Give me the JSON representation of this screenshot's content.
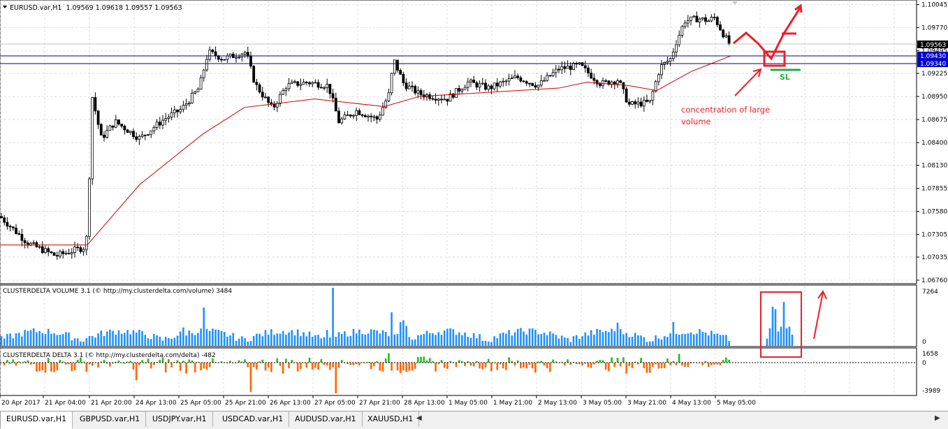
{
  "header": {
    "symbol_info": "EURUSD.var,H1",
    "ohlc": "1.09569 1.09618 1.09557 1.09563"
  },
  "price_axis": {
    "ticks": [
      "1.10045",
      "1.09770",
      "1.09495",
      "1.09225",
      "1.08950",
      "1.08675",
      "1.08400",
      "1.08130",
      "1.07855",
      "1.07580",
      "1.07305",
      "1.07035",
      "1.06760"
    ],
    "current_price": "1.09563",
    "level_upper": "1.09430",
    "level_lower": "1.09340"
  },
  "volume_panel": {
    "title": "CLUSTERDELTA VOLUME 3.1 (© http://my.clusterdelta.com/volume) 3484",
    "ticks": [
      "7264",
      "0"
    ]
  },
  "delta_panel": {
    "title": "CLUSTERDELTA DELTA 3.1 (© http://my.clusterdelta.com/delta) -482",
    "ticks": [
      "1658",
      "0",
      "-3989"
    ]
  },
  "time_axis": {
    "labels": [
      "20 Apr 2017",
      "21 Apr 04:00",
      "21 Apr 20:00",
      "24 Apr 13:00",
      "25 Apr 05:00",
      "25 Apr 21:00",
      "26 Apr 13:00",
      "27 Apr 05:00",
      "27 Apr 21:00",
      "28 Apr 13:00",
      "1 May 05:00",
      "1 May 21:00",
      "2 May 13:00",
      "3 May 05:00",
      "3 May 21:00",
      "4 May 13:00",
      "5 May 05:00"
    ]
  },
  "annotations": {
    "volume_note": "concentration of large volume",
    "sl_label": "SL"
  },
  "tabs": [
    "EURUSD.var,H1",
    "GBPUSD.var,H1",
    "USDJPY.var,H1",
    "USDCAD.var,H1",
    "AUDUSD.var,H1",
    "XAUUSD,H1"
  ],
  "colors": {
    "candle": "#000000",
    "ma": "#cc0000",
    "level_line": "#000080",
    "volume_bar": "#1e90ff",
    "delta_pos": "#22bb22",
    "delta_neg": "#ff6600",
    "annotation": "#e8202a",
    "sl": "#22aa44"
  },
  "chart_data": [
    {
      "type": "candlestick",
      "symbol": "EURUSD.var",
      "timeframe": "H1",
      "ylim": [
        1.0676,
        1.1005
      ],
      "levels": [
        1.0943,
        1.0934
      ],
      "series": [
        {
          "t": 0,
          "p": 1.0752
        },
        {
          "t": 40,
          "p": 1.072
        },
        {
          "t": 80,
          "p": 1.0705
        },
        {
          "t": 120,
          "p": 1.0715
        },
        {
          "t": 125,
          "p": 1.073
        },
        {
          "t": 132,
          "p": 1.0895
        },
        {
          "t": 145,
          "p": 1.0845
        },
        {
          "t": 165,
          "p": 1.0865
        },
        {
          "t": 200,
          "p": 1.0845
        },
        {
          "t": 235,
          "p": 1.0868
        },
        {
          "t": 260,
          "p": 1.088
        },
        {
          "t": 285,
          "p": 1.0905
        },
        {
          "t": 298,
          "p": 1.0948
        },
        {
          "t": 320,
          "p": 1.094
        },
        {
          "t": 352,
          "p": 1.0948
        },
        {
          "t": 365,
          "p": 1.091
        },
        {
          "t": 390,
          "p": 1.088
        },
        {
          "t": 410,
          "p": 1.0908
        },
        {
          "t": 440,
          "p": 1.0912
        },
        {
          "t": 470,
          "p": 1.0908
        },
        {
          "t": 485,
          "p": 1.0865
        },
        {
          "t": 510,
          "p": 1.0878
        },
        {
          "t": 540,
          "p": 1.0868
        },
        {
          "t": 558,
          "p": 1.09
        },
        {
          "t": 563,
          "p": 1.094
        },
        {
          "t": 578,
          "p": 1.091
        },
        {
          "t": 600,
          "p": 1.0898
        },
        {
          "t": 640,
          "p": 1.0892
        },
        {
          "t": 670,
          "p": 1.0912
        },
        {
          "t": 700,
          "p": 1.0905
        },
        {
          "t": 740,
          "p": 1.0918
        },
        {
          "t": 770,
          "p": 1.0908
        },
        {
          "t": 800,
          "p": 1.0928
        },
        {
          "t": 830,
          "p": 1.0932
        },
        {
          "t": 860,
          "p": 1.091
        },
        {
          "t": 885,
          "p": 1.0915
        },
        {
          "t": 900,
          "p": 1.0885
        },
        {
          "t": 930,
          "p": 1.0888
        },
        {
          "t": 945,
          "p": 1.093
        },
        {
          "t": 960,
          "p": 1.094
        },
        {
          "t": 968,
          "p": 1.096
        },
        {
          "t": 980,
          "p": 1.0985
        },
        {
          "t": 1000,
          "p": 1.0988
        },
        {
          "t": 1015,
          "p": 1.0985
        },
        {
          "t": 1022,
          "p": 1.099
        },
        {
          "t": 1035,
          "p": 1.097
        },
        {
          "t": 1045,
          "p": 1.0956
        }
      ]
    },
    {
      "type": "line",
      "name": "",
      "series": [
        {
          "t": 0,
          "p": 1.0718
        },
        {
          "t": 80,
          "p": 1.0718
        },
        {
          "t": 125,
          "p": 1.0718
        },
        {
          "t": 200,
          "p": 1.079
        },
        {
          "t": 290,
          "p": 1.085
        },
        {
          "t": 350,
          "p": 1.0882
        },
        {
          "t": 450,
          "p": 1.0892
        },
        {
          "t": 550,
          "p": 1.0883
        },
        {
          "t": 600,
          "p": 1.0895
        },
        {
          "t": 700,
          "p": 1.09
        },
        {
          "t": 800,
          "p": 1.0905
        },
        {
          "t": 840,
          "p": 1.0912
        },
        {
          "t": 900,
          "p": 1.0908
        },
        {
          "t": 940,
          "p": 1.0902
        },
        {
          "t": 990,
          "p": 1.0925
        },
        {
          "t": 1045,
          "p": 1.0943
        }
      ]
    },
    {
      "type": "bar",
      "name": "CLUSTERDELTA VOLUME 3.1",
      "ylim": [
        0,
        7264
      ]
    },
    {
      "type": "bar",
      "name": "CLUSTERDELTA DELTA 3.1",
      "ylim": [
        -3989,
        1658
      ]
    }
  ]
}
